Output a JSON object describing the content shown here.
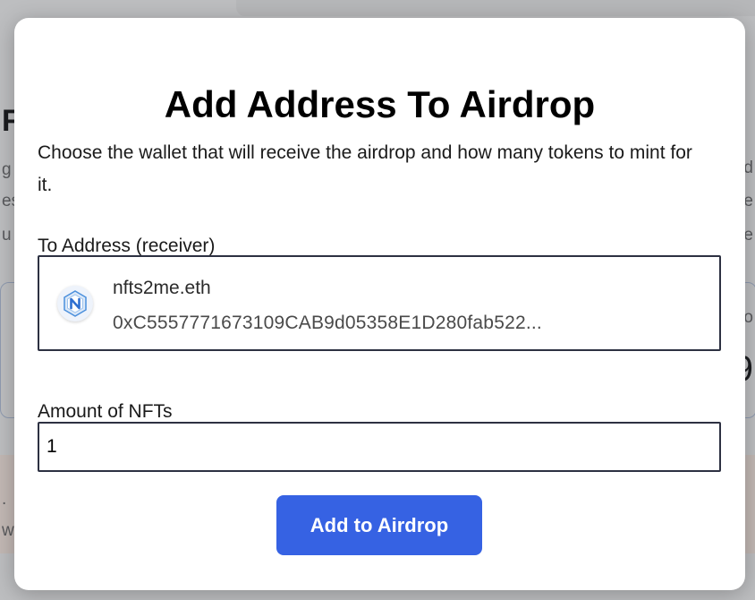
{
  "background": {
    "fragments_left": [
      "F",
      "g",
      "es",
      "u",
      ".",
      "w"
    ],
    "fragments_right": [
      "d",
      "e",
      "e",
      "ro",
      "9"
    ]
  },
  "modal": {
    "title": "Add Address To Airdrop",
    "description": "Choose the wallet that will receive the airdrop and how many tokens to mint for it.",
    "to_address": {
      "label": "To Address (receiver)",
      "avatar_icon": "nfts2me-logo-icon",
      "ens_name": "nfts2me.eth",
      "address": "0xC5557771673109CAB9d05358E1D280fab522..."
    },
    "amount": {
      "label": "Amount of NFTs",
      "value": "1"
    },
    "submit_label": "Add to Airdrop"
  },
  "colors": {
    "primary": "#3662e3",
    "border": "#2d3142",
    "overlay": "#9a9b9d"
  }
}
